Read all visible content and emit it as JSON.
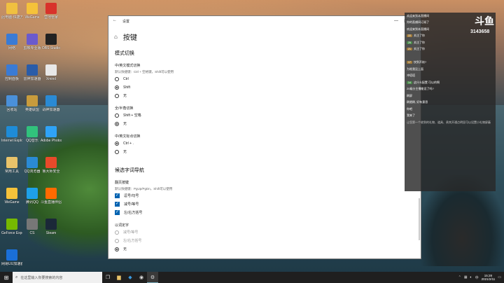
{
  "desktop": {
    "icons": [
      {
        "label": "此电脑-快捷方式",
        "color": "#f0c040"
      },
      {
        "label": "WeGame",
        "color": "#f5c23a"
      },
      {
        "label": "营地管家",
        "color": "#d8332b"
      },
      {
        "label": "网络",
        "color": "#3a7bd5"
      },
      {
        "label": "剪映专业版",
        "color": "#6a5acd"
      },
      {
        "label": "OBS Studio",
        "color": "#222222"
      },
      {
        "label": "控制面板",
        "color": "#3a7bd5"
      },
      {
        "label": "雷神加速器",
        "color": "#2a5ca8"
      },
      {
        "label": "Xmind",
        "color": "#e8e8e8"
      },
      {
        "label": "回收站",
        "color": "#4a90d9"
      },
      {
        "label": "英雄联盟",
        "color": "#c89b3c"
      },
      {
        "label": "战神加速器",
        "color": "#2a8ad4"
      },
      {
        "label": "Internet Explorer",
        "color": "#1e8cd8"
      },
      {
        "label": "QQ音乐",
        "color": "#31c27c"
      },
      {
        "label": "Adobe Photosh...",
        "color": "#2fa3f7"
      },
      {
        "label": "常用工具",
        "color": "#e8c36a"
      },
      {
        "label": "QQ浏览器",
        "color": "#2a8ad4"
      },
      {
        "label": "鲁大师安全",
        "color": "#e84a2a"
      },
      {
        "label": "WeGame",
        "color": "#f5c23a"
      },
      {
        "label": "腾讯QQ",
        "color": "#1ea0e8"
      },
      {
        "label": "斗鱼直播伴侣",
        "color": "#ff6a00"
      },
      {
        "label": "GeForce Experience",
        "color": "#76b900"
      },
      {
        "label": "CS",
        "color": "#777777"
      },
      {
        "label": "Steam",
        "color": "#1b2838"
      },
      {
        "label": "网易UU加速器",
        "color": "#1a6fd8"
      }
    ]
  },
  "settings": {
    "window_title": "设置",
    "page_title": "按键",
    "sections": {
      "mode_switch": {
        "title": "模式切换",
        "groups": [
          {
            "label": "中/英文模式切换",
            "hint": "默认快捷键：Ctrl + 空格键，Shift可以使用",
            "options": [
              {
                "label": "Ctrl",
                "selected": false
              },
              {
                "label": "Shift",
                "selected": true
              },
              {
                "label": "无",
                "selected": false
              }
            ]
          },
          {
            "label": "全/半角切换",
            "options": [
              {
                "label": "Shift + 空格",
                "selected": false
              },
              {
                "label": "无",
                "selected": true
              }
            ]
          },
          {
            "label": "中/英文标点切换",
            "options": [
              {
                "label": "Ctrl + .",
                "selected": true
              },
              {
                "label": "无",
                "selected": false
              }
            ]
          }
        ]
      },
      "candidate_nav": {
        "title": "候选字词导航",
        "page_turn": {
          "label": "翻页按键",
          "hint": "默认快捷键：PgUp/PgDn，Shift可以使用",
          "options": [
            {
              "label": "逗号/句号",
              "checked": true
            },
            {
              "label": "减号/等号",
              "checked": true
            },
            {
              "label": "左/右方括号",
              "checked": true
            }
          ]
        },
        "select_char": {
          "label": "以词定字",
          "options": [
            {
              "label": "减号/等号",
              "selected": false,
              "disabled": true
            },
            {
              "label": "左/右方括号",
              "selected": false,
              "disabled": true
            },
            {
              "label": "无",
              "selected": true,
              "disabled": false
            }
          ]
        }
      }
    }
  },
  "chat": {
    "logo": "斗鱼",
    "logo_sub": "房间号",
    "room_number": "3143658",
    "messages": [
      {
        "level": "",
        "nick": "",
        "text": "欢迎来到本直播间"
      },
      {
        "level": "",
        "nick": "",
        "text": "你的直播间订阅了"
      },
      {
        "level": "",
        "nick": "",
        "text": "欢迎来到本直播间"
      },
      {
        "level": "22",
        "nick": "",
        "text": "关注了你"
      },
      {
        "level": "25",
        "nick": "",
        "text": "关注了你"
      },
      {
        "level": "21",
        "nick": "",
        "text": "关注了你"
      },
      {
        "level": "",
        "nick": "",
        "text": ""
      },
      {
        "level": "17",
        "nick": "",
        "text": "快到开始?"
      },
      {
        "level": "",
        "nick": "",
        "text": "为啥我没上面"
      },
      {
        "level": "",
        "nick": "",
        "text": "冲塔塔"
      },
      {
        "level": "14",
        "nick": "",
        "text": "这什么配置 可以的啊"
      },
      {
        "level": "",
        "nick": "",
        "text": "20级分主播能设了吗?"
      },
      {
        "level": "",
        "nick": "",
        "text": "刷屏"
      },
      {
        "level": "",
        "nick": "",
        "text": "刷就刷, 好有意思"
      },
      {
        "level": "",
        "nick": "",
        "text": "你吧"
      },
      {
        "level": "",
        "nick": "",
        "text": "我来了"
      }
    ],
    "tip": "让您第一个收到的礼物、道具、贵宾开通点明显可以设置小礼物屏蔽"
  },
  "taskbar": {
    "search_placeholder": "在这里输入你要搜索的内容",
    "time": "15:28",
    "date": "2021/2/11",
    "lang": "中",
    "apps": [
      "file-explorer",
      "tencent-game",
      "steam",
      "epic",
      "settings"
    ]
  }
}
